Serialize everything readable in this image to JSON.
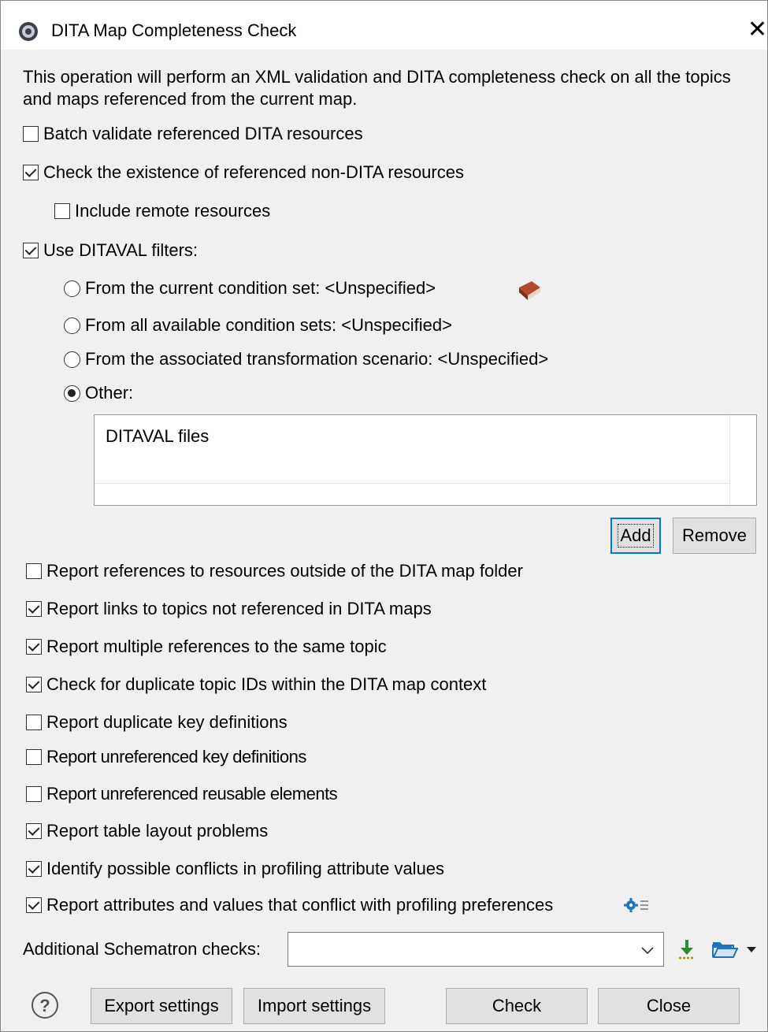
{
  "title": "DITA Map Completeness Check",
  "description": "This operation will perform an XML validation and DITA completeness check on all the topics and maps referenced from the current map.",
  "options_top": [
    {
      "label": "Batch validate referenced DITA resources",
      "checked": false
    },
    {
      "label": "Check the existence of referenced non-DITA resources",
      "checked": true
    },
    {
      "label": "Include remote resources",
      "checked": false
    },
    {
      "label": "Use DITAVAL filters:",
      "checked": true
    }
  ],
  "filter_options": [
    {
      "label": "From the current condition set: <Unspecified>",
      "selected": false
    },
    {
      "label": "From all available condition sets:  <Unspecified>",
      "selected": false
    },
    {
      "label": "From the associated transformation scenario: <Unspecified>",
      "selected": false
    },
    {
      "label": "Other:",
      "selected": true
    }
  ],
  "ditaval_list": {
    "header": "DITAVAL files"
  },
  "list_buttons": {
    "add": "Add",
    "remove": "Remove"
  },
  "report_options": [
    {
      "label": "Report references to resources outside of the DITA map folder",
      "checked": false
    },
    {
      "label": "Report links to topics not referenced in DITA maps",
      "checked": true
    },
    {
      "label": "Report multiple references to the same topic",
      "checked": true
    },
    {
      "label": "Check for duplicate topic IDs within the DITA map context",
      "checked": true
    },
    {
      "label": "Report duplicate key definitions",
      "checked": false
    },
    {
      "label": "Report unreferenced key definitions",
      "checked": false
    },
    {
      "label": "Report unreferenced reusable elements",
      "checked": false
    },
    {
      "label": "Report table layout problems",
      "checked": true
    },
    {
      "label": "Identify possible conflicts in profiling attribute values",
      "checked": true
    },
    {
      "label": "Report attributes and values that conflict with profiling preferences",
      "checked": true
    }
  ],
  "schematron": {
    "label": "Additional Schematron checks:",
    "value": ""
  },
  "footer": {
    "export": "Export settings",
    "import": "Import settings",
    "check": "Check",
    "close": "Close"
  },
  "icons": {
    "app": "settings-app-icon",
    "close": "close-icon",
    "book": "book-icon",
    "gear": "gear-list-icon",
    "download": "download-icon",
    "folder": "folder-open-icon",
    "dropdown": "dropdown-arrow-icon",
    "help": "help-icon"
  },
  "colors": {
    "accent": "#0078d7",
    "book": "#a0402a",
    "gear": "#1e73be",
    "download": "#2e8b2e"
  }
}
